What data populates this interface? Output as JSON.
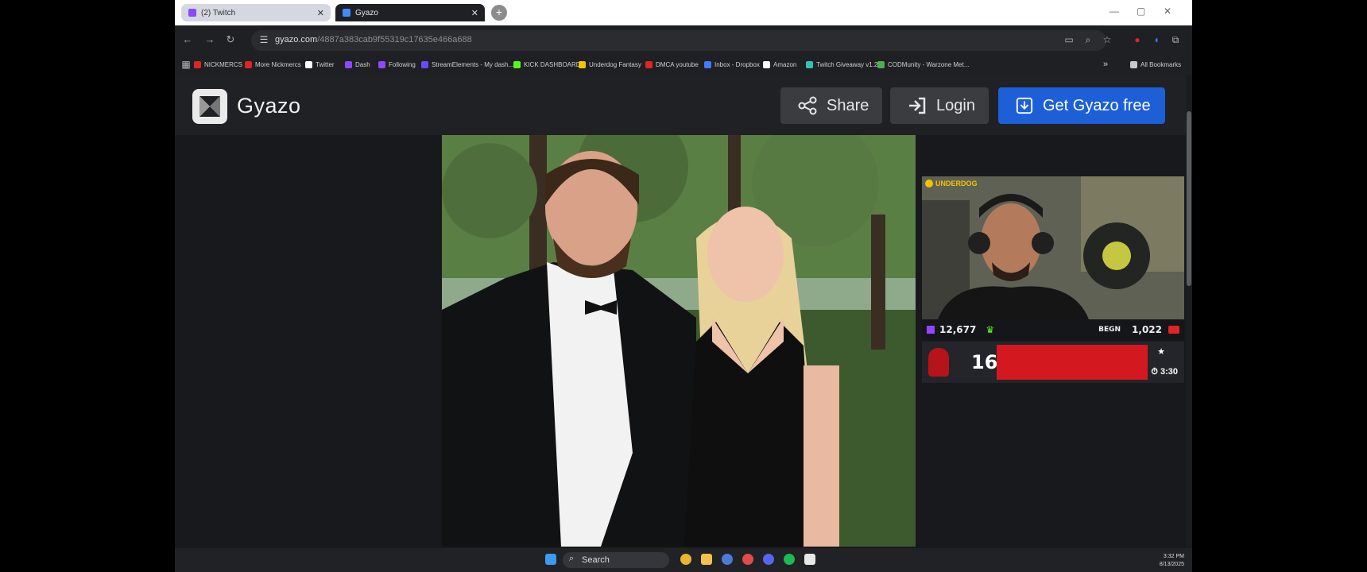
{
  "browser": {
    "tabs": [
      {
        "label": "(2) Twitch",
        "active": false
      },
      {
        "label": "Gyazo",
        "active": true
      }
    ],
    "url_host": "gyazo.com",
    "url_path": "/4887a383cab9f55319c17635e466a688",
    "bookmarks": [
      {
        "label": "NICKMERCS",
        "color": "#e02424"
      },
      {
        "label": "More Nickmercs",
        "color": "#e02424"
      },
      {
        "label": "Twitter",
        "color": "#ffffff"
      },
      {
        "label": "Dash",
        "color": "#9146ff"
      },
      {
        "label": "Following",
        "color": "#9146ff"
      },
      {
        "label": "StreamElements - My dash...",
        "color": "#6b47ff"
      },
      {
        "label": "KICK DASHBOARD",
        "color": "#53fc18"
      },
      {
        "label": "Underdog Fantasy",
        "color": "#f5c400"
      },
      {
        "label": "DMCA youtube",
        "color": "#e02424"
      },
      {
        "label": "Inbox - Dropbox",
        "color": "#3f7bff"
      },
      {
        "label": "Amazon",
        "color": "#ffffff"
      },
      {
        "label": "Twitch Giveaway v1.2",
        "color": "#2ec4b6"
      },
      {
        "label": "CODMunity - Warzone Met...",
        "color": "#4caf50"
      }
    ],
    "all_bookmarks": "All Bookmarks"
  },
  "gyazo": {
    "logo_text": "Gyazo",
    "share_label": "Share",
    "login_label": "Login",
    "get_label": "Get Gyazo free",
    "accent": "#1c5fd6"
  },
  "stream_overlay": {
    "sponsor": "UNDERDOG",
    "followers": "12,677",
    "channel_tag": "BEGN",
    "viewers": "1,022",
    "alert_count": "168",
    "timer": "3:30"
  },
  "taskbar": {
    "search_label": "Search",
    "time": "3:32 PM",
    "date": "8/13/2025"
  }
}
